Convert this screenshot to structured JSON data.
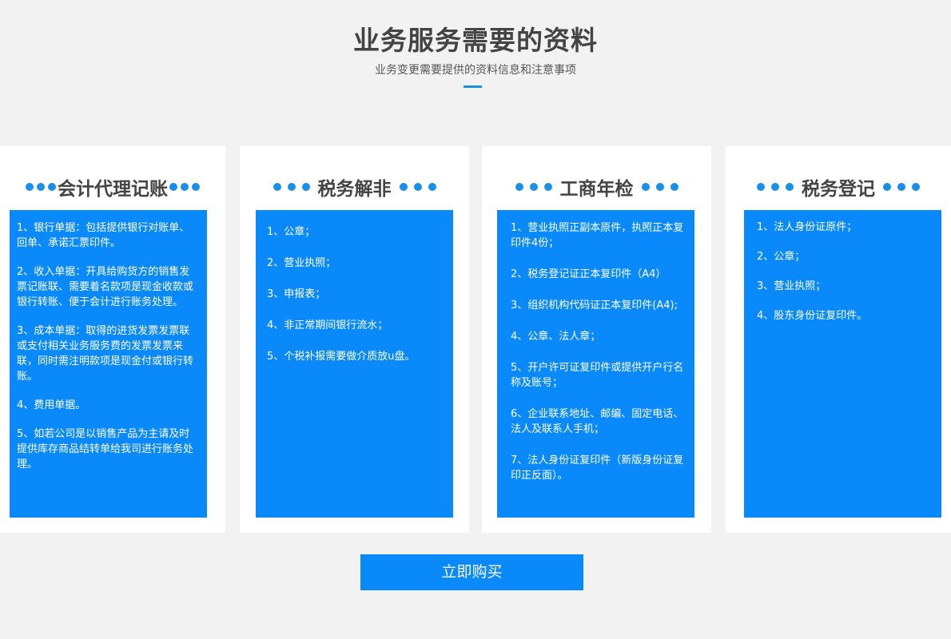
{
  "header": {
    "title": "业务服务需要的资料",
    "subtitle": "业务变更需要提供的资料信息和注意事项"
  },
  "cards": [
    {
      "title": "会计代理记账",
      "items": [
        "1、银行单据：包括提供银行对账单、回单、承诺汇票印件。",
        "2、收入单据：开具给购货方的销售发票记账联、需要着名款项是现金收款或银行转账、便于会计进行账务处理。",
        "3、成本单据：取得的进货发票发票联或支付相关业务服务费的发票发票来联，同时需注明款项是现金付或银行转账。",
        "4、费用单据。",
        "5、如若公司是以销售产品为主请及时提供库存商品结转单给我司进行账务处理。"
      ]
    },
    {
      "title": "税务解非",
      "items": [
        "1、公章；",
        "2、营业执照；",
        "3、申报表；",
        "4、非正常期间银行流水；",
        "5、个税补报需要做介质放u盘。"
      ]
    },
    {
      "title": "工商年检",
      "items": [
        "1、营业执照正副本原件，执照正本复印件4份；",
        "2、税务登记证正本复印件（A4）",
        "3、组织机构代码证正本复印件(A4);",
        "4、公章、法人章；",
        "5、开户许可证复印件或提供开户行名称及账号；",
        "6、企业联系地址、邮编、固定电话、法人及联系人手机；",
        "7、法人身份证复印件（新版身份证复印正反面）。"
      ]
    },
    {
      "title": "税务登记",
      "items": [
        "1、法人身份证原件；",
        "2、公章；",
        "3、营业执照；",
        "4、股东身份证复印件。"
      ]
    }
  ],
  "buy_button": {
    "label": "立即购买"
  },
  "colors": {
    "accent": "#0a8afa",
    "background": "#f2f2f2",
    "title_text": "#444444"
  }
}
